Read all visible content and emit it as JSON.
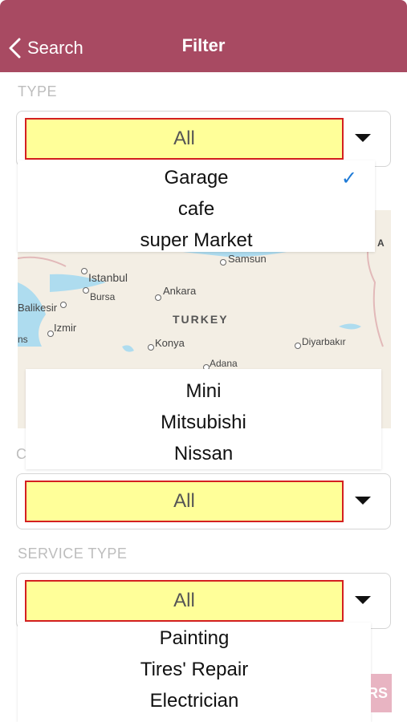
{
  "header": {
    "back_label": "Search",
    "title": "Filter"
  },
  "type_section": {
    "label": "TYPE",
    "selected": "All",
    "options": [
      {
        "label": "Garage",
        "checked": true
      },
      {
        "label": "cafe",
        "checked": false
      },
      {
        "label": "super Market",
        "checked": false
      }
    ]
  },
  "map": {
    "country": "TURKEY",
    "cities": [
      "Samsun",
      "Istanbul",
      "Bursa",
      "Ankara",
      "Balikesir",
      "Izmir",
      "Konya",
      "Adana",
      "Diyarbakır"
    ],
    "edge_left": "ns",
    "edge_right": "A"
  },
  "car_section": {
    "label_visible": "C",
    "selected": "All",
    "options": [
      "Mini",
      "Mitsubishi",
      "Nissan"
    ]
  },
  "service_section": {
    "label": "SERVICE TYPE",
    "selected": "All",
    "options": [
      "Painting",
      "Tires' Repair",
      "Electrician"
    ]
  },
  "action_button": {
    "label_fragment": "RS"
  },
  "colors": {
    "header_bg": "#a84a62",
    "selected_bg": "#ffff99",
    "selected_border": "#d42020",
    "check": "#1e7ad6"
  }
}
